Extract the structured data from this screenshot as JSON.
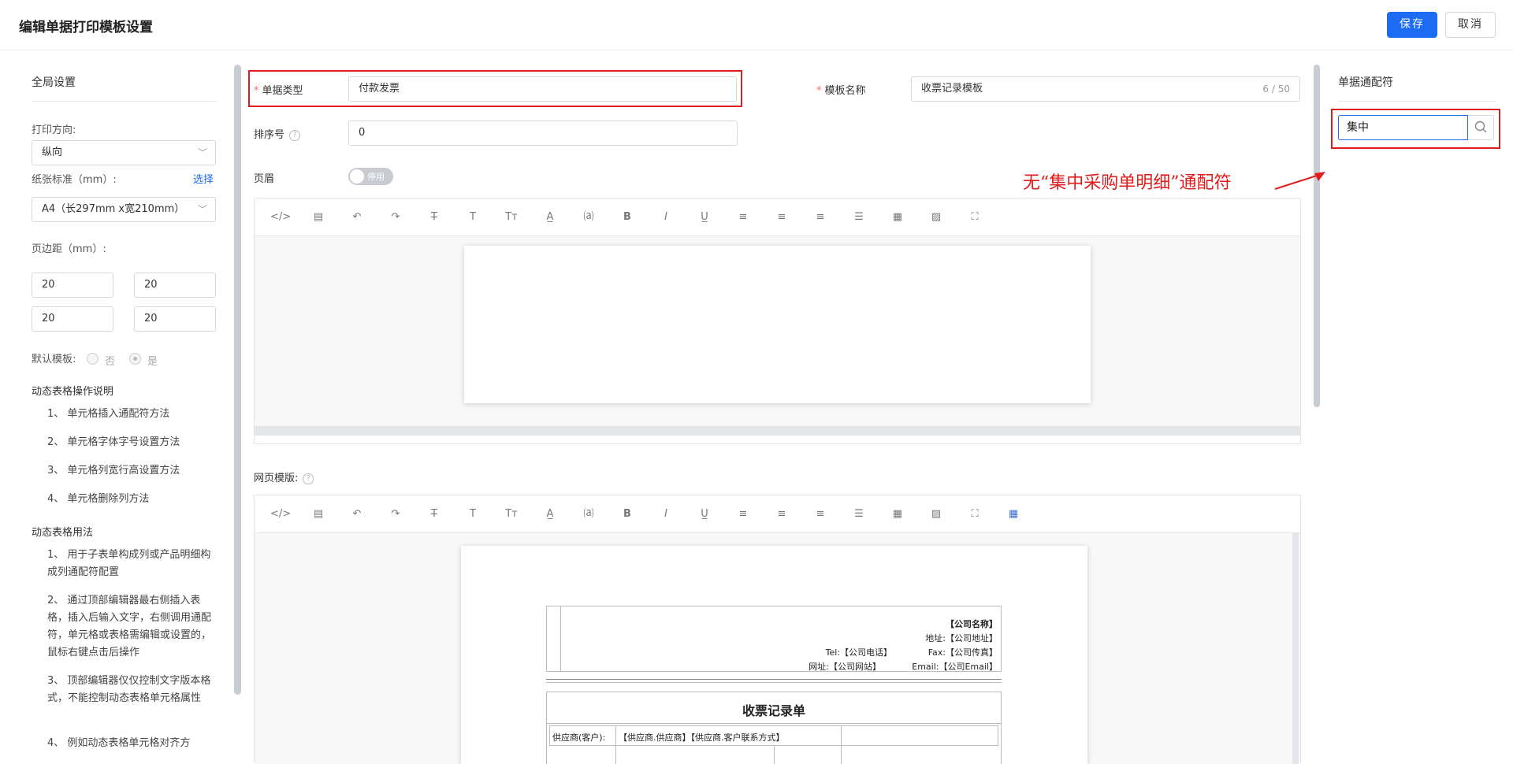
{
  "header": {
    "title": "编辑单据打印模板设置",
    "save": "保存",
    "cancel": "取消"
  },
  "global": {
    "title": "全局设置",
    "orientation_label": "打印方向:",
    "orientation_value": "纵向",
    "paper_label": "纸张标准（mm）:",
    "paper_link": "选择",
    "paper_value": "A4（长297mm x宽210mm）",
    "margin_label": "页边距（mm）:",
    "margins": [
      "20",
      "20",
      "20",
      "20"
    ],
    "default_label": "默认模板:",
    "default_no": "否",
    "default_yes": "是",
    "default_selected": "是"
  },
  "help": {
    "ops_title": "动态表格操作说明",
    "ops": [
      "1、 单元格插入通配符方法",
      "2、 单元格字体字号设置方法",
      "3、 单元格列宽行高设置方法",
      "4、 单元格删除列方法"
    ],
    "usage_title": "动态表格用法",
    "usage": [
      "1、 用于子表单构成列或产品明细构成列通配符配置",
      "2、 通过顶部编辑器最右侧插入表格，插入后输入文字，右侧调用通配符，单元格或表格需编辑或设置的，鼠标右键点击后操作",
      "3、 顶部编辑器仅仅控制文字版本格式，不能控制动态表格单元格属性",
      "4、 例如动态表格单元格对齐方"
    ]
  },
  "form": {
    "doc_type_label": "单据类型",
    "doc_type_value": "付款发票",
    "template_name_label": "模板名称",
    "template_name_value": "收票记录模板",
    "template_name_counter": "6 / 50",
    "sort_label": "排序号",
    "sort_value": "0",
    "header_label": "页眉",
    "header_toggle": "停用",
    "web_template_label": "网页模版:"
  },
  "toolbar_icons": [
    "code-icon",
    "template-icon",
    "undo-icon",
    "redo-icon",
    "strikethrough-icon",
    "font-icon",
    "font-size-icon",
    "font-color-icon",
    "background-color-icon",
    "bold-icon",
    "italic-icon",
    "underline-icon",
    "align-left-icon",
    "align-center-icon",
    "align-right-icon",
    "line-height-icon",
    "table-icon",
    "image-icon",
    "fullscreen-icon",
    "dynamic-table-icon"
  ],
  "receipt": {
    "company": "【公司名称】",
    "address": "地址:【公司地址】",
    "tel": "Tel:【公司电话】",
    "fax": "Fax:【公司传真】",
    "website": "网址:【公司网站】",
    "email": "Email:【公司Email】",
    "title": "收票记录单",
    "supplier_label": "供应商(客户):",
    "supplier_value": "【供应商.供应商】【供应商.客户联系方式】"
  },
  "annotation": "无“集中采购单明细”通配符",
  "annotation_color": "#e01c1c",
  "right": {
    "title": "单据通配符",
    "search_value": "集中"
  }
}
